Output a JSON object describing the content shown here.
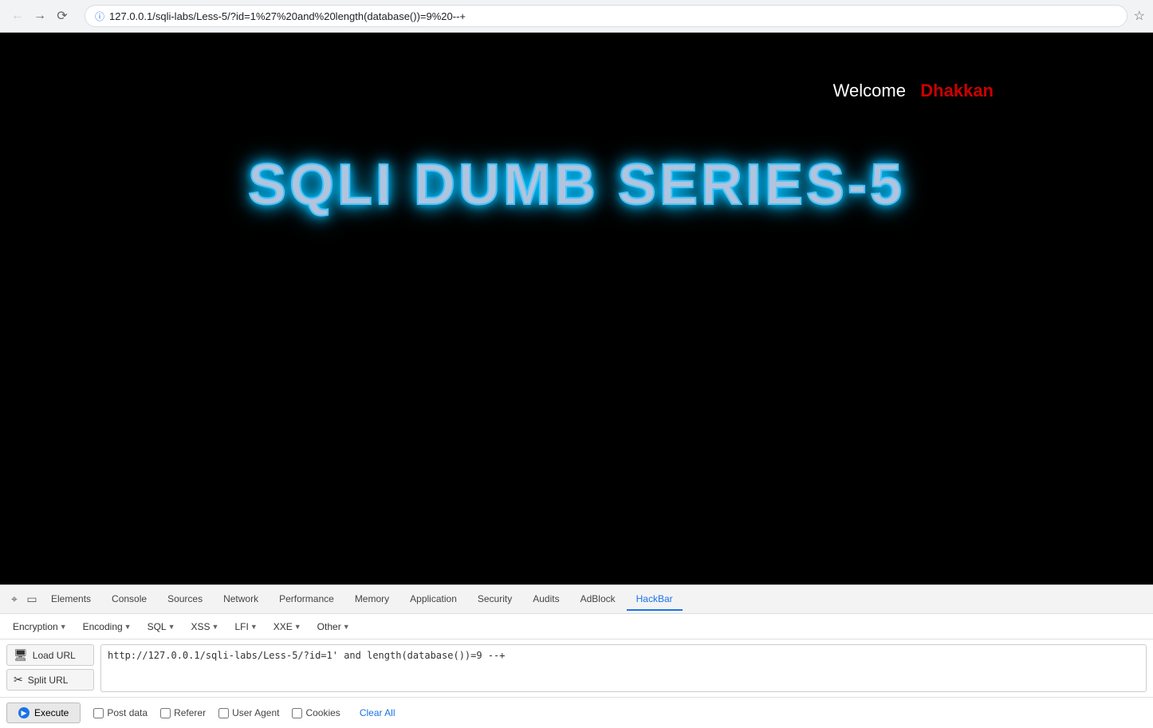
{
  "browser": {
    "url": "127.0.0.1/sqli-labs/Less-5/?id=1%27%20and%20length(database())=9%20--+",
    "back_disabled": true,
    "forward_disabled": false
  },
  "page": {
    "welcome_label": "Welcome",
    "username": "Dhakkan",
    "main_title": "SQLI DUMB SERIES-5"
  },
  "devtools": {
    "tabs": [
      {
        "id": "elements",
        "label": "Elements"
      },
      {
        "id": "console",
        "label": "Console"
      },
      {
        "id": "sources",
        "label": "Sources"
      },
      {
        "id": "network",
        "label": "Network"
      },
      {
        "id": "performance",
        "label": "Performance"
      },
      {
        "id": "memory",
        "label": "Memory"
      },
      {
        "id": "application",
        "label": "Application"
      },
      {
        "id": "security",
        "label": "Security"
      },
      {
        "id": "audits",
        "label": "Audits"
      },
      {
        "id": "adblock",
        "label": "AdBlock"
      },
      {
        "id": "hackbar",
        "label": "HackBar"
      }
    ]
  },
  "hackbar": {
    "menu": [
      {
        "id": "encryption",
        "label": "Encryption",
        "has_dropdown": true
      },
      {
        "id": "encoding",
        "label": "Encoding",
        "has_dropdown": true
      },
      {
        "id": "sql",
        "label": "SQL",
        "has_dropdown": true
      },
      {
        "id": "xss",
        "label": "XSS",
        "has_dropdown": true
      },
      {
        "id": "lfi",
        "label": "LFI",
        "has_dropdown": true
      },
      {
        "id": "xxe",
        "label": "XXE",
        "has_dropdown": true
      },
      {
        "id": "other",
        "label": "Other",
        "has_dropdown": true
      }
    ],
    "load_url_label": "Load URL",
    "split_url_label": "Split URL",
    "execute_label": "Execute",
    "url_value": "http://127.0.0.1/sqli-labs/Less-5/?id=1' and length(database())=9 --+",
    "footer": {
      "post_data_label": "Post data",
      "referer_label": "Referer",
      "user_agent_label": "User Agent",
      "cookies_label": "Cookies",
      "clear_all_label": "Clear All"
    }
  }
}
